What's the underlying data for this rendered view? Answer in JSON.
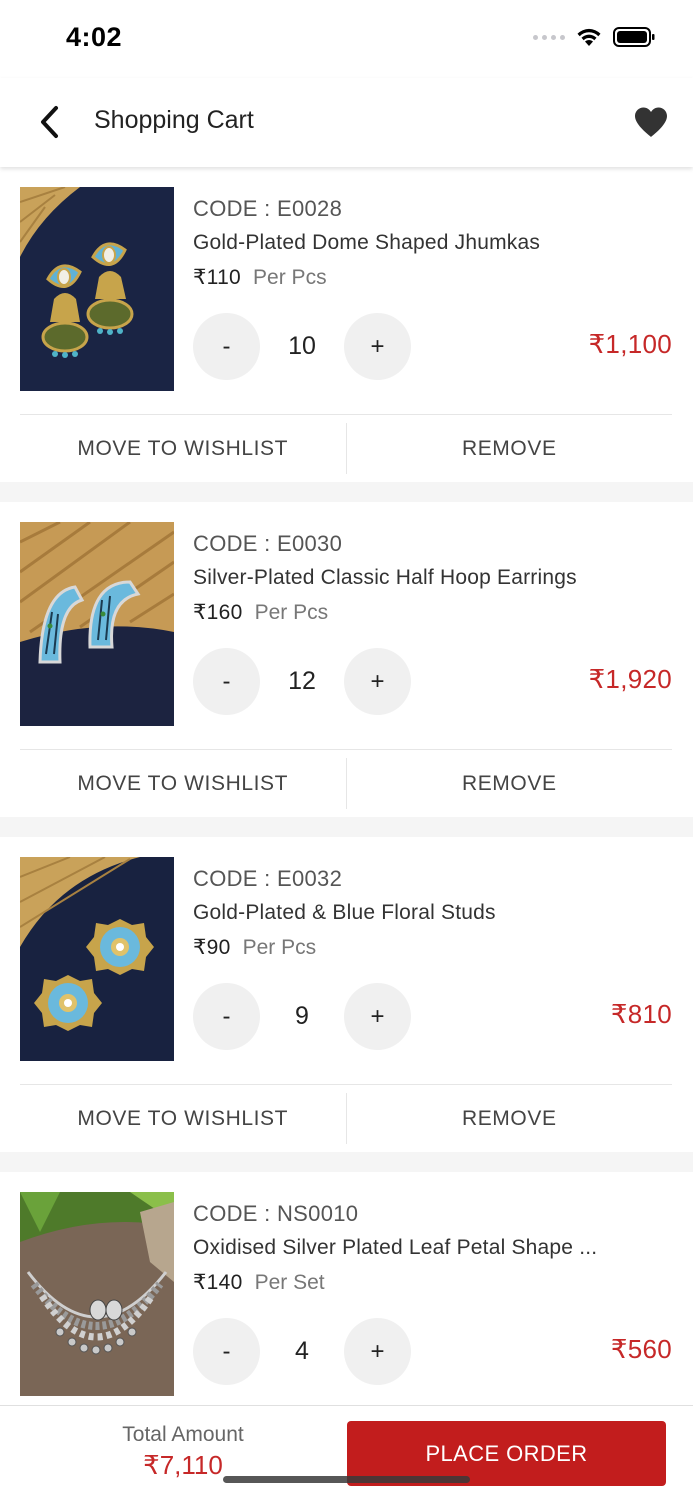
{
  "status_bar": {
    "time": "4:02"
  },
  "header": {
    "title": "Shopping Cart"
  },
  "cart": {
    "move_label": "MOVE TO WISHLIST",
    "remove_label": "REMOVE",
    "items": [
      {
        "code": "CODE : E0028",
        "name": "Gold-Plated Dome Shaped Jhumkas",
        "price": "₹110",
        "unit": "Per Pcs",
        "qty": "10",
        "total": "₹1,100"
      },
      {
        "code": "CODE : E0030",
        "name": "Silver-Plated Classic Half Hoop Earrings",
        "price": "₹160",
        "unit": "Per Pcs",
        "qty": "12",
        "total": "₹1,920"
      },
      {
        "code": "CODE : E0032",
        "name": "Gold-Plated & Blue Floral Studs",
        "price": "₹90",
        "unit": "Per Pcs",
        "qty": "9",
        "total": "₹810"
      },
      {
        "code": "CODE : NS0010",
        "name": "Oxidised Silver Plated Leaf Petal Shape ...",
        "price": "₹140",
        "unit": "Per Set",
        "qty": "4",
        "total": "₹560"
      }
    ]
  },
  "footer": {
    "total_label": "Total Amount",
    "total_value": "₹7,110",
    "place_order_label": "PLACE ORDER"
  },
  "colors": {
    "accent": "#c21d1d",
    "price_total": "#c62828"
  }
}
